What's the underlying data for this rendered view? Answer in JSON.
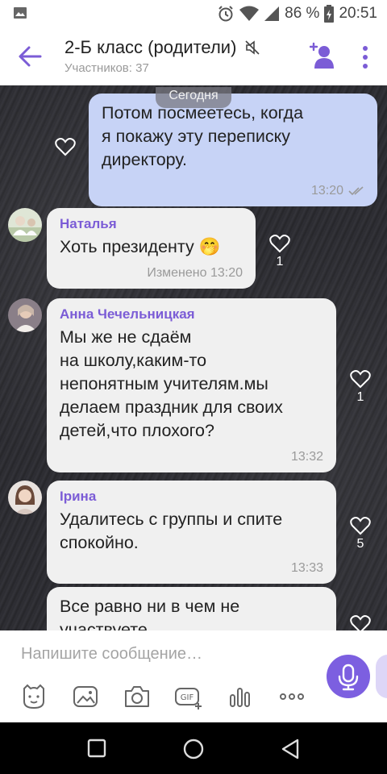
{
  "status_bar": {
    "battery_percent": "86 %",
    "time": "20:51",
    "icons": [
      "gallery-icon",
      "alarm-icon",
      "wifi-icon",
      "signal-icon",
      "battery-icon"
    ]
  },
  "header": {
    "title": "2-Б класс (родители)",
    "subtitle": "Участников: 37",
    "icons": [
      "back-arrow-icon",
      "mute-icon",
      "add-member-icon",
      "more-vertical-icon"
    ],
    "accent_color": "#7b5cd6"
  },
  "chat": {
    "date_chip": "Сегодня",
    "messages": [
      {
        "direction": "out",
        "text": "Потом посмеетесь, когда\nя покажу эту переписку\nдиректору.",
        "time": "13:20",
        "status_icon": "double-check-icon"
      },
      {
        "direction": "in",
        "sender": "Наталья",
        "text": "Хоть президенту 🤭",
        "time": "Изменено 13:20",
        "likes": "1"
      },
      {
        "direction": "in",
        "sender": "Анна Чечельницкая",
        "text": "Мы же не сдаём\nна школу,каким-то\nнепонятным учителям.мы\nделаем праздник для своих\nдетей,что плохого?",
        "time": "13:32",
        "likes": "1"
      },
      {
        "direction": "in",
        "sender": "Ірина",
        "text": "Удалитесь с группы и спите\nспокойно.",
        "time": "13:33",
        "likes": "5"
      },
      {
        "direction": "in",
        "text": "Все равно ни в чем не\nучаствуете"
      }
    ]
  },
  "composer": {
    "placeholder": "Напишите сообщение…",
    "tools": [
      "sticker-icon",
      "gallery-icon",
      "camera-icon",
      "gif-icon",
      "poll-icon",
      "more-horizontal-icon"
    ],
    "mic_color": "#7c5fe0"
  },
  "nav_bar": {
    "buttons": [
      "recents-icon",
      "home-icon",
      "back-icon"
    ]
  }
}
